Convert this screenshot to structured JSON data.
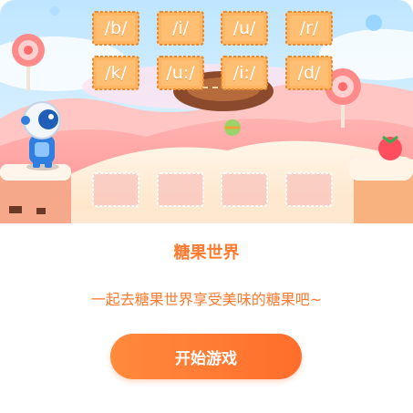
{
  "scene": {
    "phoneme_tiles": [
      {
        "label": "/b/"
      },
      {
        "label": "/i/"
      },
      {
        "label": "/u/"
      },
      {
        "label": "/r/"
      },
      {
        "label": "/k/"
      },
      {
        "label": "/u:/"
      },
      {
        "label": "/i:/"
      },
      {
        "label": "/d/"
      }
    ],
    "answer_slot_count": 4,
    "colors": {
      "sky": "#d8f1ff",
      "tile": "#ffb562",
      "tile_border": "#e88a2f",
      "pink_hill": "#ff9aa0",
      "cream_hill": "#fff0dc",
      "slot_border": "#ffffff"
    }
  },
  "game": {
    "title": "糖果世界",
    "description": "一起去糖果世界享受美味的糖果吧~",
    "start_label": "开始游戏"
  }
}
